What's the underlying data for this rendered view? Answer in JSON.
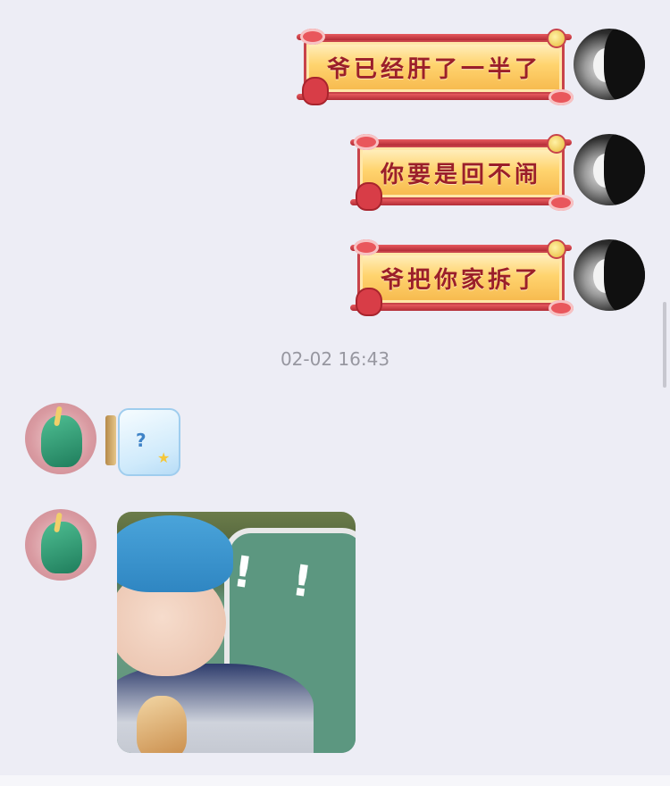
{
  "messages": [
    {
      "side": "self",
      "text": "爷已经肝了一半了"
    },
    {
      "side": "self",
      "text": "你要是回不闹"
    },
    {
      "side": "self",
      "text": "爷把你家拆了"
    }
  ],
  "timestamp": "02-02 16:43",
  "sticker": {
    "glyph": "?",
    "star": "★"
  },
  "photo": {
    "marks": [
      "!",
      "!"
    ]
  }
}
